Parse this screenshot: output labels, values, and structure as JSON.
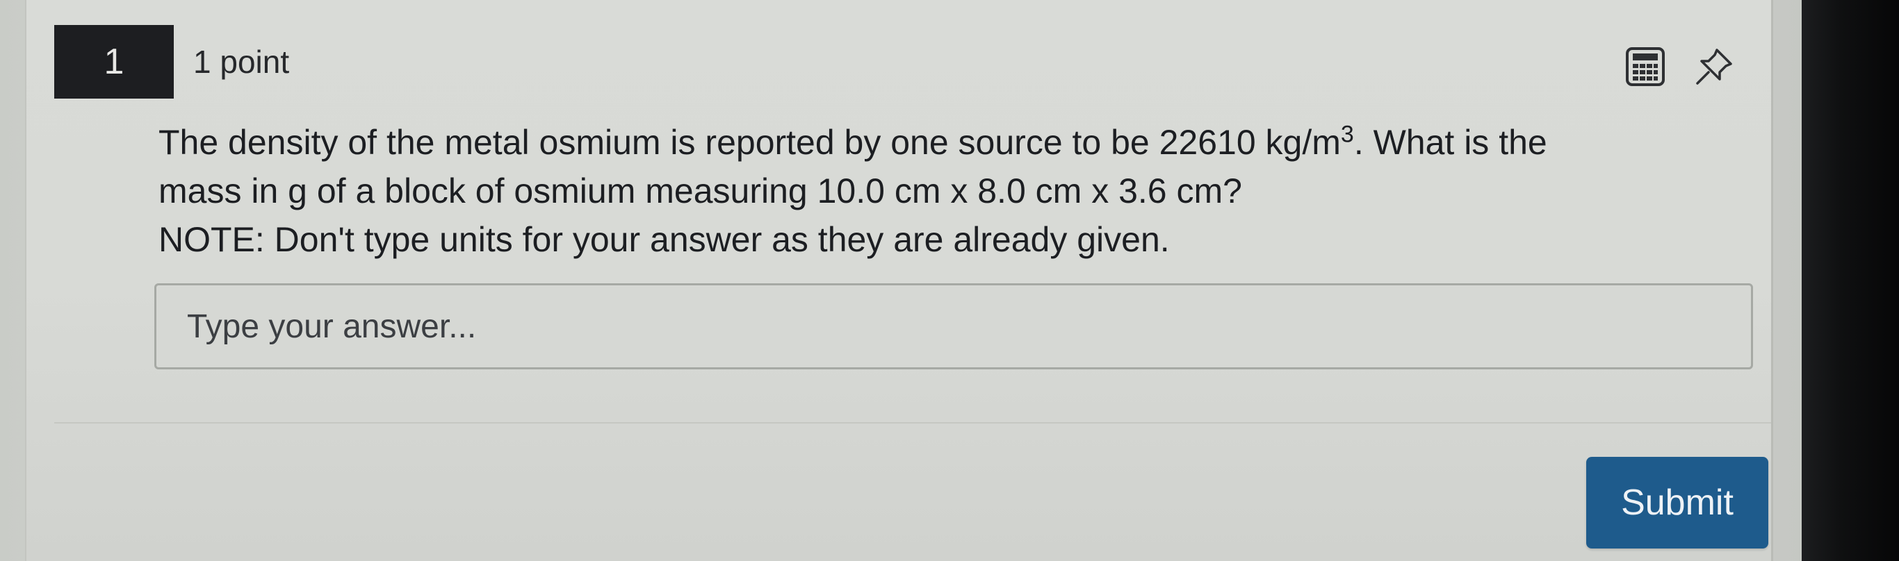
{
  "question": {
    "number": "1",
    "points": "1 point",
    "text_line1_a": "The density of the metal osmium is reported by one source to be 22610 kg/m",
    "superscript": "3",
    "text_line1_b": ". What is the",
    "text_line2": "mass in g of a block of osmium measuring 10.0 cm x 8.0 cm x 3.6 cm?",
    "note": "NOTE: Don't type units for your answer as they are already given."
  },
  "answer": {
    "placeholder": "Type your answer...",
    "value": ""
  },
  "toolbar": {
    "calculator_icon": "calculator-icon",
    "pin_icon": "pin-icon"
  },
  "actions": {
    "submit_label": "Submit"
  },
  "colors": {
    "submit_button": "#1e5b8c",
    "question_badge": "#1d1e21"
  }
}
